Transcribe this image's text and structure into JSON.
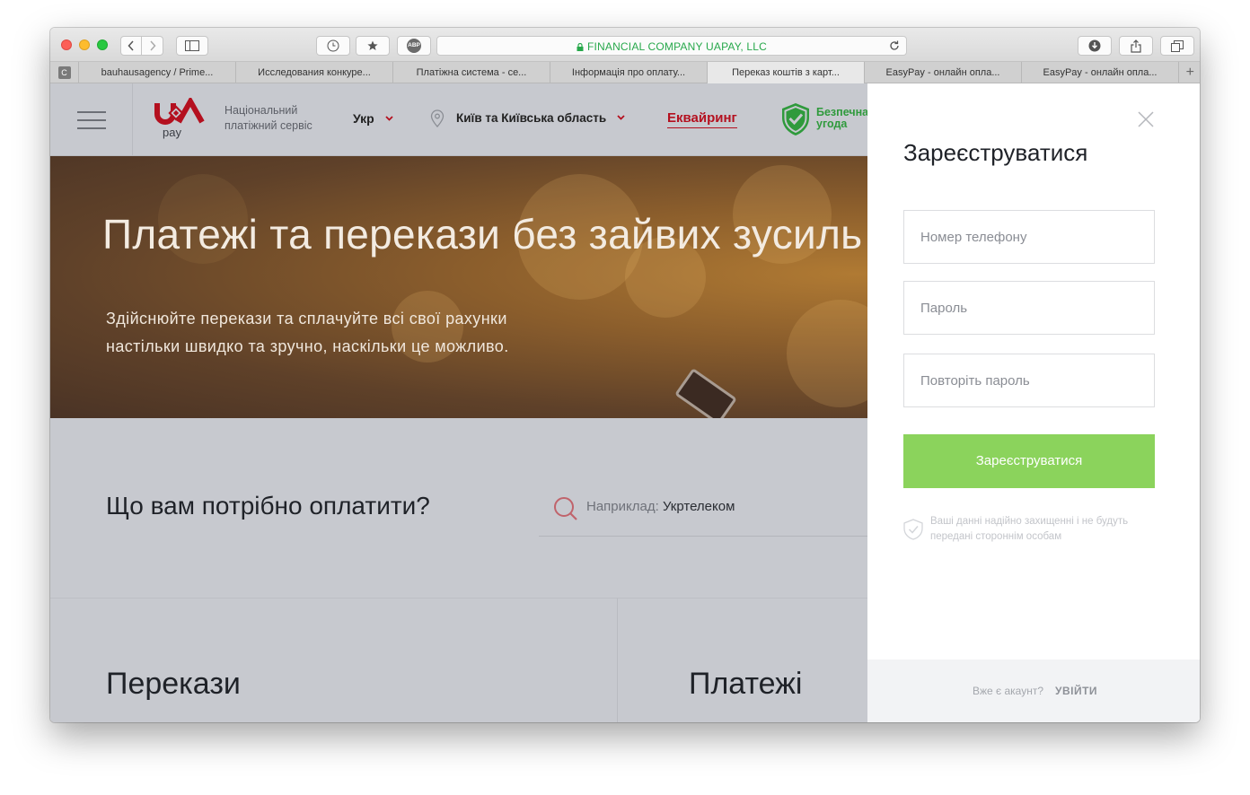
{
  "browser": {
    "url_text": "FINANCIAL COMPANY UAPAY, LLC",
    "abp_label": "ABP",
    "tabs": [
      {
        "label": "bauhausagency / Prime..."
      },
      {
        "label": "Исследования конкуре..."
      },
      {
        "label": "Платіжна система - се..."
      },
      {
        "label": "Інформація про оплату..."
      },
      {
        "label": "Переказ коштів з карт..."
      },
      {
        "label": "EasyPay - онлайн опла..."
      },
      {
        "label": "EasyPay - онлайн опла..."
      }
    ],
    "favicon_letter": "C",
    "active_tab_index": 4
  },
  "header": {
    "logo_text": "pay",
    "national_line1": "Національний",
    "national_line2": "платіжний сервіс",
    "language": "Укр",
    "region": "Київ та Київська область",
    "acquiring": "Еквайринг",
    "safe_line1": "Безпечна",
    "safe_line2": "угода"
  },
  "hero": {
    "title": "Платежі та перекази без зайвих зусиль",
    "subtitle_line1": "Здійснюйте перекази та сплачуйте всі свої рахунки",
    "subtitle_line2": "настільки швидко та зручно, наскільки це можливо."
  },
  "search": {
    "question": "Що вам потрібно оплатити?",
    "example_prefix": "Наприклад:",
    "example_value": "Укртелеком"
  },
  "cards": {
    "transfers": "Перекази",
    "payments": "Платежі"
  },
  "register_panel": {
    "title": "Зареєструватися",
    "phone_placeholder": "Номер телефону",
    "password_placeholder": "Пароль",
    "repeat_password_placeholder": "Повторіть пароль",
    "submit_label": "Зареєструватися",
    "safe_note": "Ваші данні надійно захищенні і не будуть передані стороннім особам",
    "have_account": "Вже є акаунт?",
    "login_label": "УВІЙТИ"
  },
  "colors": {
    "brand_red": "#b4101f",
    "button_green": "#8bd35c",
    "secure_green": "#2f9a3c",
    "url_green": "#27a84b"
  }
}
